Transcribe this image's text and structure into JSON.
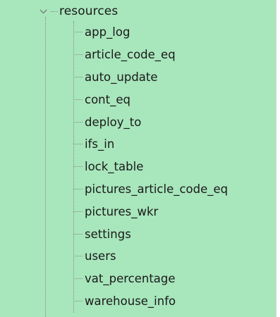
{
  "colors": {
    "panel_bg": "#a8e6bc"
  },
  "tree": {
    "root": {
      "label": "resources",
      "expander_icon": "chevron-down-icon",
      "expanded": true
    },
    "children": [
      {
        "label": "app_log"
      },
      {
        "label": "article_code_eq"
      },
      {
        "label": "auto_update"
      },
      {
        "label": "cont_eq"
      },
      {
        "label": "deploy_to"
      },
      {
        "label": "ifs_in"
      },
      {
        "label": "lock_table"
      },
      {
        "label": "pictures_article_code_eq"
      },
      {
        "label": "pictures_wkr"
      },
      {
        "label": "settings"
      },
      {
        "label": "users"
      },
      {
        "label": "vat_percentage"
      },
      {
        "label": "warehouse_info"
      }
    ]
  }
}
